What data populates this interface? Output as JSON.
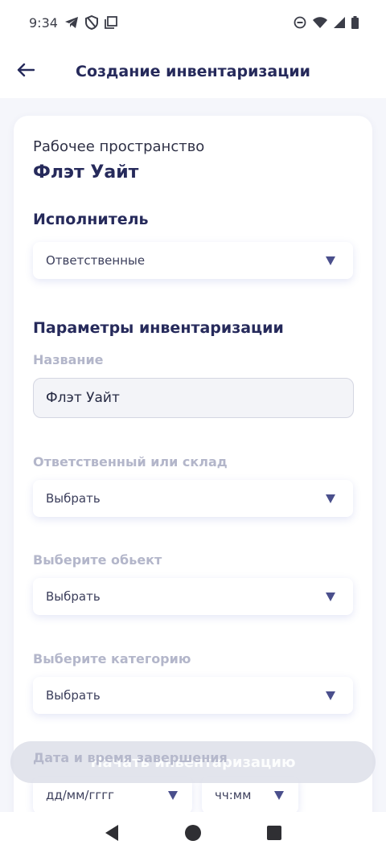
{
  "status_bar": {
    "time": "9:34",
    "icons": [
      "telegram-icon",
      "shield-icon",
      "copy-icon",
      "do-not-disturb-icon",
      "wifi-icon",
      "signal-icon",
      "battery-icon"
    ]
  },
  "header": {
    "title": "Создание инвентаризации",
    "back_icon": "arrow-left-icon"
  },
  "workspace": {
    "label": "Рабочее пространство",
    "name": "Флэт Уайт"
  },
  "executor": {
    "title": "Исполнитель",
    "select_value": "Ответственные"
  },
  "params": {
    "title": "Параметры инвентаризации",
    "name_label": "Название",
    "name_value": "Флэт Уайт",
    "responsible_label": "Ответственный или склад",
    "responsible_value": "Выбрать",
    "object_label": "Выберите обьект",
    "object_value": "Выбрать",
    "category_label": "Выберите категорию",
    "category_value": "Выбрать",
    "datetime_label": "Дата и время завершения",
    "date_placeholder": "дд/мм/гггг",
    "time_placeholder": "чч:мм"
  },
  "actions": {
    "start_label": "Начать инвентаризацию"
  },
  "colors": {
    "primary_text": "#262a5b",
    "muted_label": "#b3b6ca",
    "caret": "#4a4f8c",
    "background": "#f5f6fb"
  },
  "nav_bar": {
    "icons": [
      "back-triangle-icon",
      "home-circle-icon",
      "recents-square-icon"
    ]
  }
}
